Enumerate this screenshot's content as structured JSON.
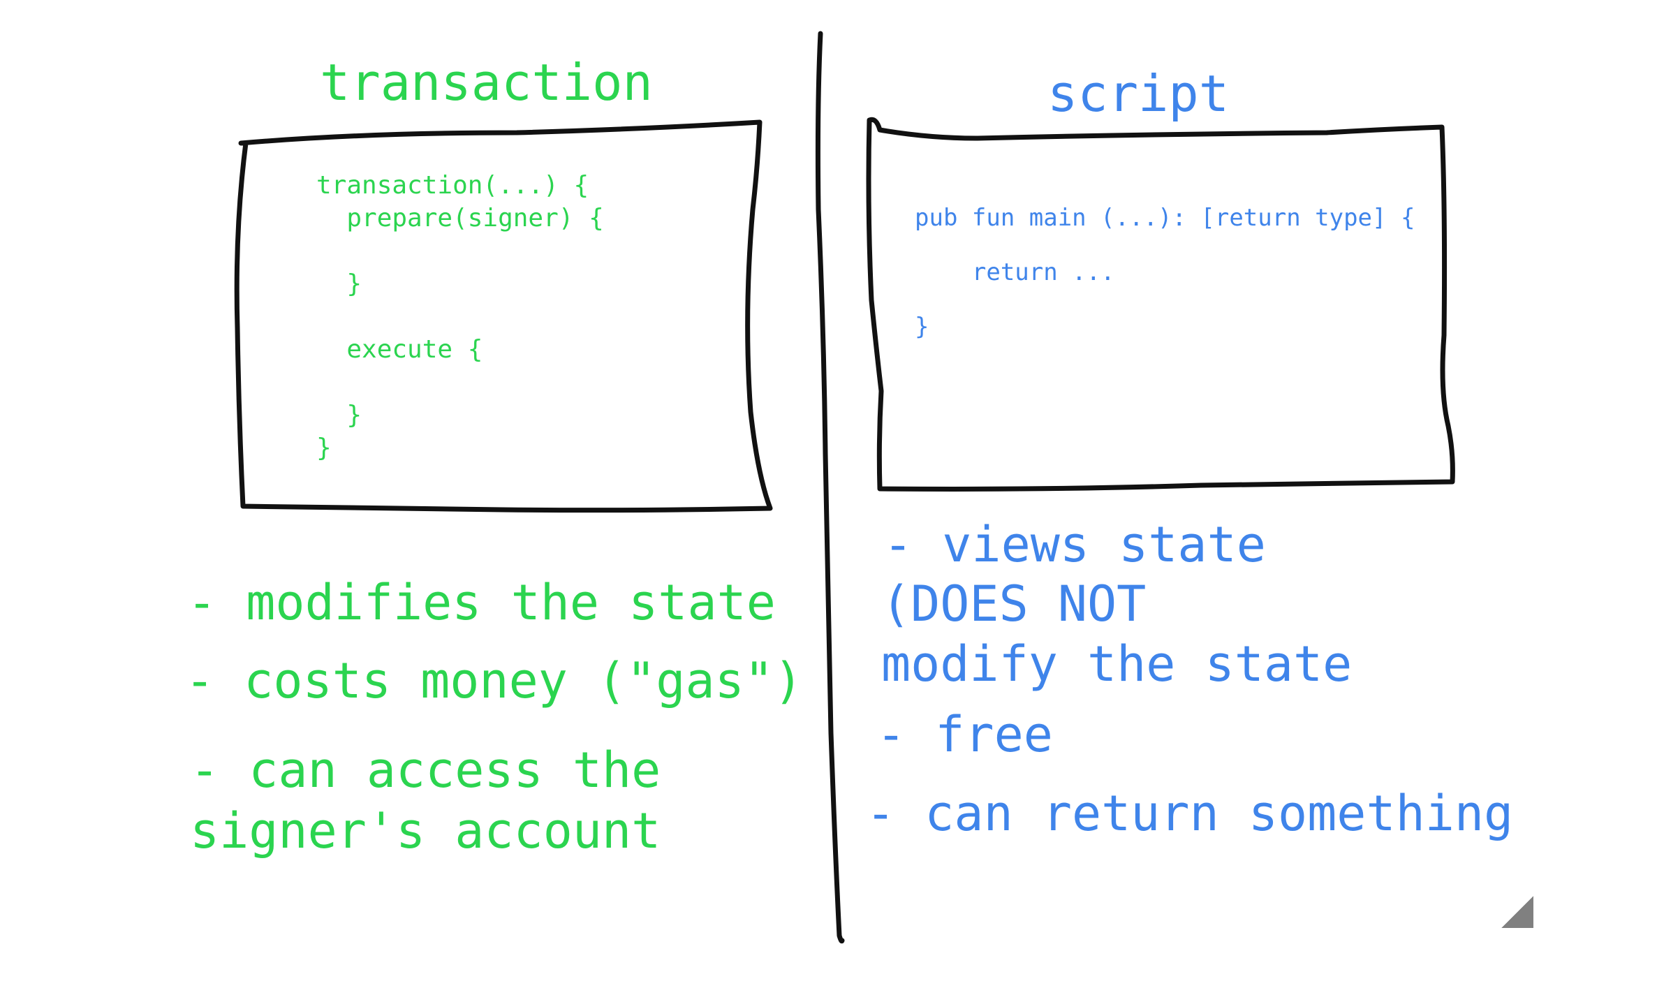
{
  "left": {
    "title": "transaction",
    "code": [
      "transaction(...) {",
      "  prepare(signer) {",
      "",
      "  }",
      "",
      "  execute {",
      "",
      "  }",
      "}"
    ],
    "notes": [
      "- modifies the state",
      "- costs money (\"gas\")",
      "- can access the",
      "signer's account"
    ]
  },
  "right": {
    "title": "script",
    "code": [
      "pub fun main (...): [return type] {",
      "",
      "    return ...",
      "",
      "}"
    ],
    "notes": [
      "- views state",
      "(DOES NOT",
      "modify the state",
      "- free",
      "- can return something"
    ]
  },
  "colors": {
    "green": "#2bd44f",
    "blue": "#3f84ea",
    "ink": "#111111"
  },
  "icons": {
    "corner": "resize-corner-icon"
  }
}
